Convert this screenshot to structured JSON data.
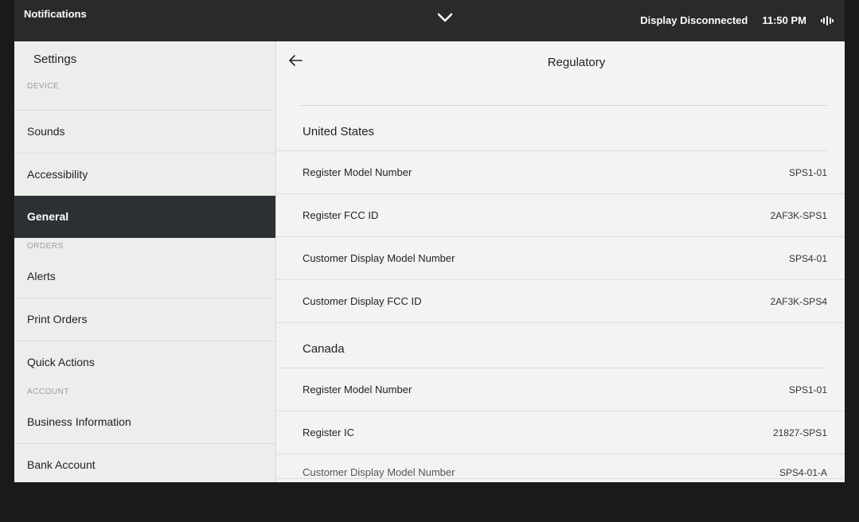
{
  "status": {
    "left_label": "Notifications",
    "display_status": "Display Disconnected",
    "time": "11:50 PM"
  },
  "sidebar": {
    "title": "Settings",
    "sections": [
      {
        "header": "DEVICE"
      },
      {
        "items": [
          "Sounds",
          "Accessibility",
          "General"
        ]
      },
      {
        "header": "ORDERS"
      },
      {
        "items": [
          "Alerts",
          "Print Orders",
          "Quick Actions"
        ]
      },
      {
        "header": "ACCOUNT"
      },
      {
        "items": [
          "Business Information",
          "Bank Account"
        ]
      }
    ],
    "active": "General"
  },
  "page": {
    "title": "Regulatory",
    "regions": [
      {
        "name": "United States",
        "rows": [
          {
            "label": "Register Model Number",
            "value": "SPS1-01"
          },
          {
            "label": "Register FCC ID",
            "value": "2AF3K-SPS1"
          },
          {
            "label": "Customer Display Model Number",
            "value": "SPS4-01"
          },
          {
            "label": "Customer Display FCC ID",
            "value": "2AF3K-SPS4"
          }
        ]
      },
      {
        "name": "Canada",
        "rows": [
          {
            "label": "Register Model Number",
            "value": "SPS1-01"
          },
          {
            "label": "Register IC",
            "value": "21827-SPS1"
          },
          {
            "label": "Customer Display Model Number",
            "value": "SPS4-01-A"
          }
        ]
      }
    ]
  }
}
